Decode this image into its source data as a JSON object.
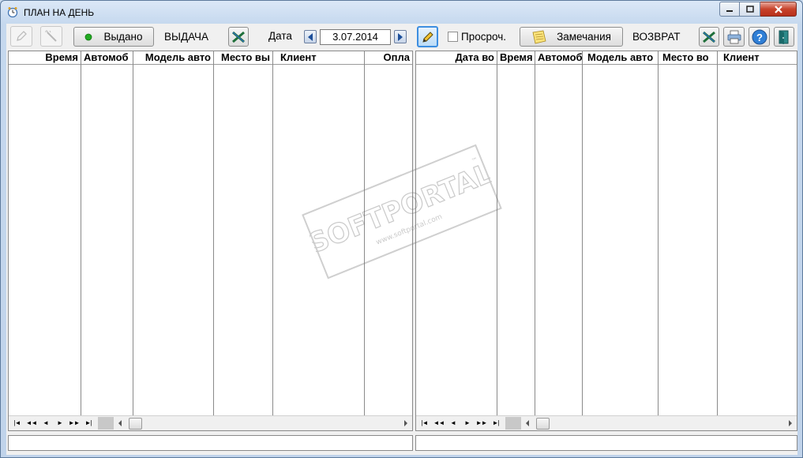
{
  "window": {
    "title": "ПЛАН НА ДЕНЬ"
  },
  "toolbar": {
    "issued_button": "Выдано",
    "issue_label": "ВЫДАЧА",
    "date_label": "Дата",
    "date_value": "3.07.2014",
    "overdue_label": "Просроч.",
    "overdue_checked": false,
    "remarks_button": "Замечания",
    "return_label": "ВОЗВРАТ"
  },
  "left_grid": {
    "columns": [
      "Время",
      "Автомоб",
      "Модель авто",
      "Место вы",
      "Клиент",
      "Опла"
    ],
    "rows": []
  },
  "right_grid": {
    "columns": [
      "Дата во",
      "Время",
      "Автомоб",
      "Модель авто",
      "Место во",
      "Клиент"
    ],
    "rows": []
  },
  "nav_buttons": [
    "|◄",
    "◄◄",
    "◄",
    "►",
    "►►",
    "►|"
  ],
  "watermark": {
    "brand": "SOFTPORTAL",
    "url": "www.softportal.com",
    "tm": "™"
  },
  "colors": {
    "accent_blue": "#2f6fc6",
    "green_dot": "#22aa22",
    "close_red": "#c7432b"
  }
}
